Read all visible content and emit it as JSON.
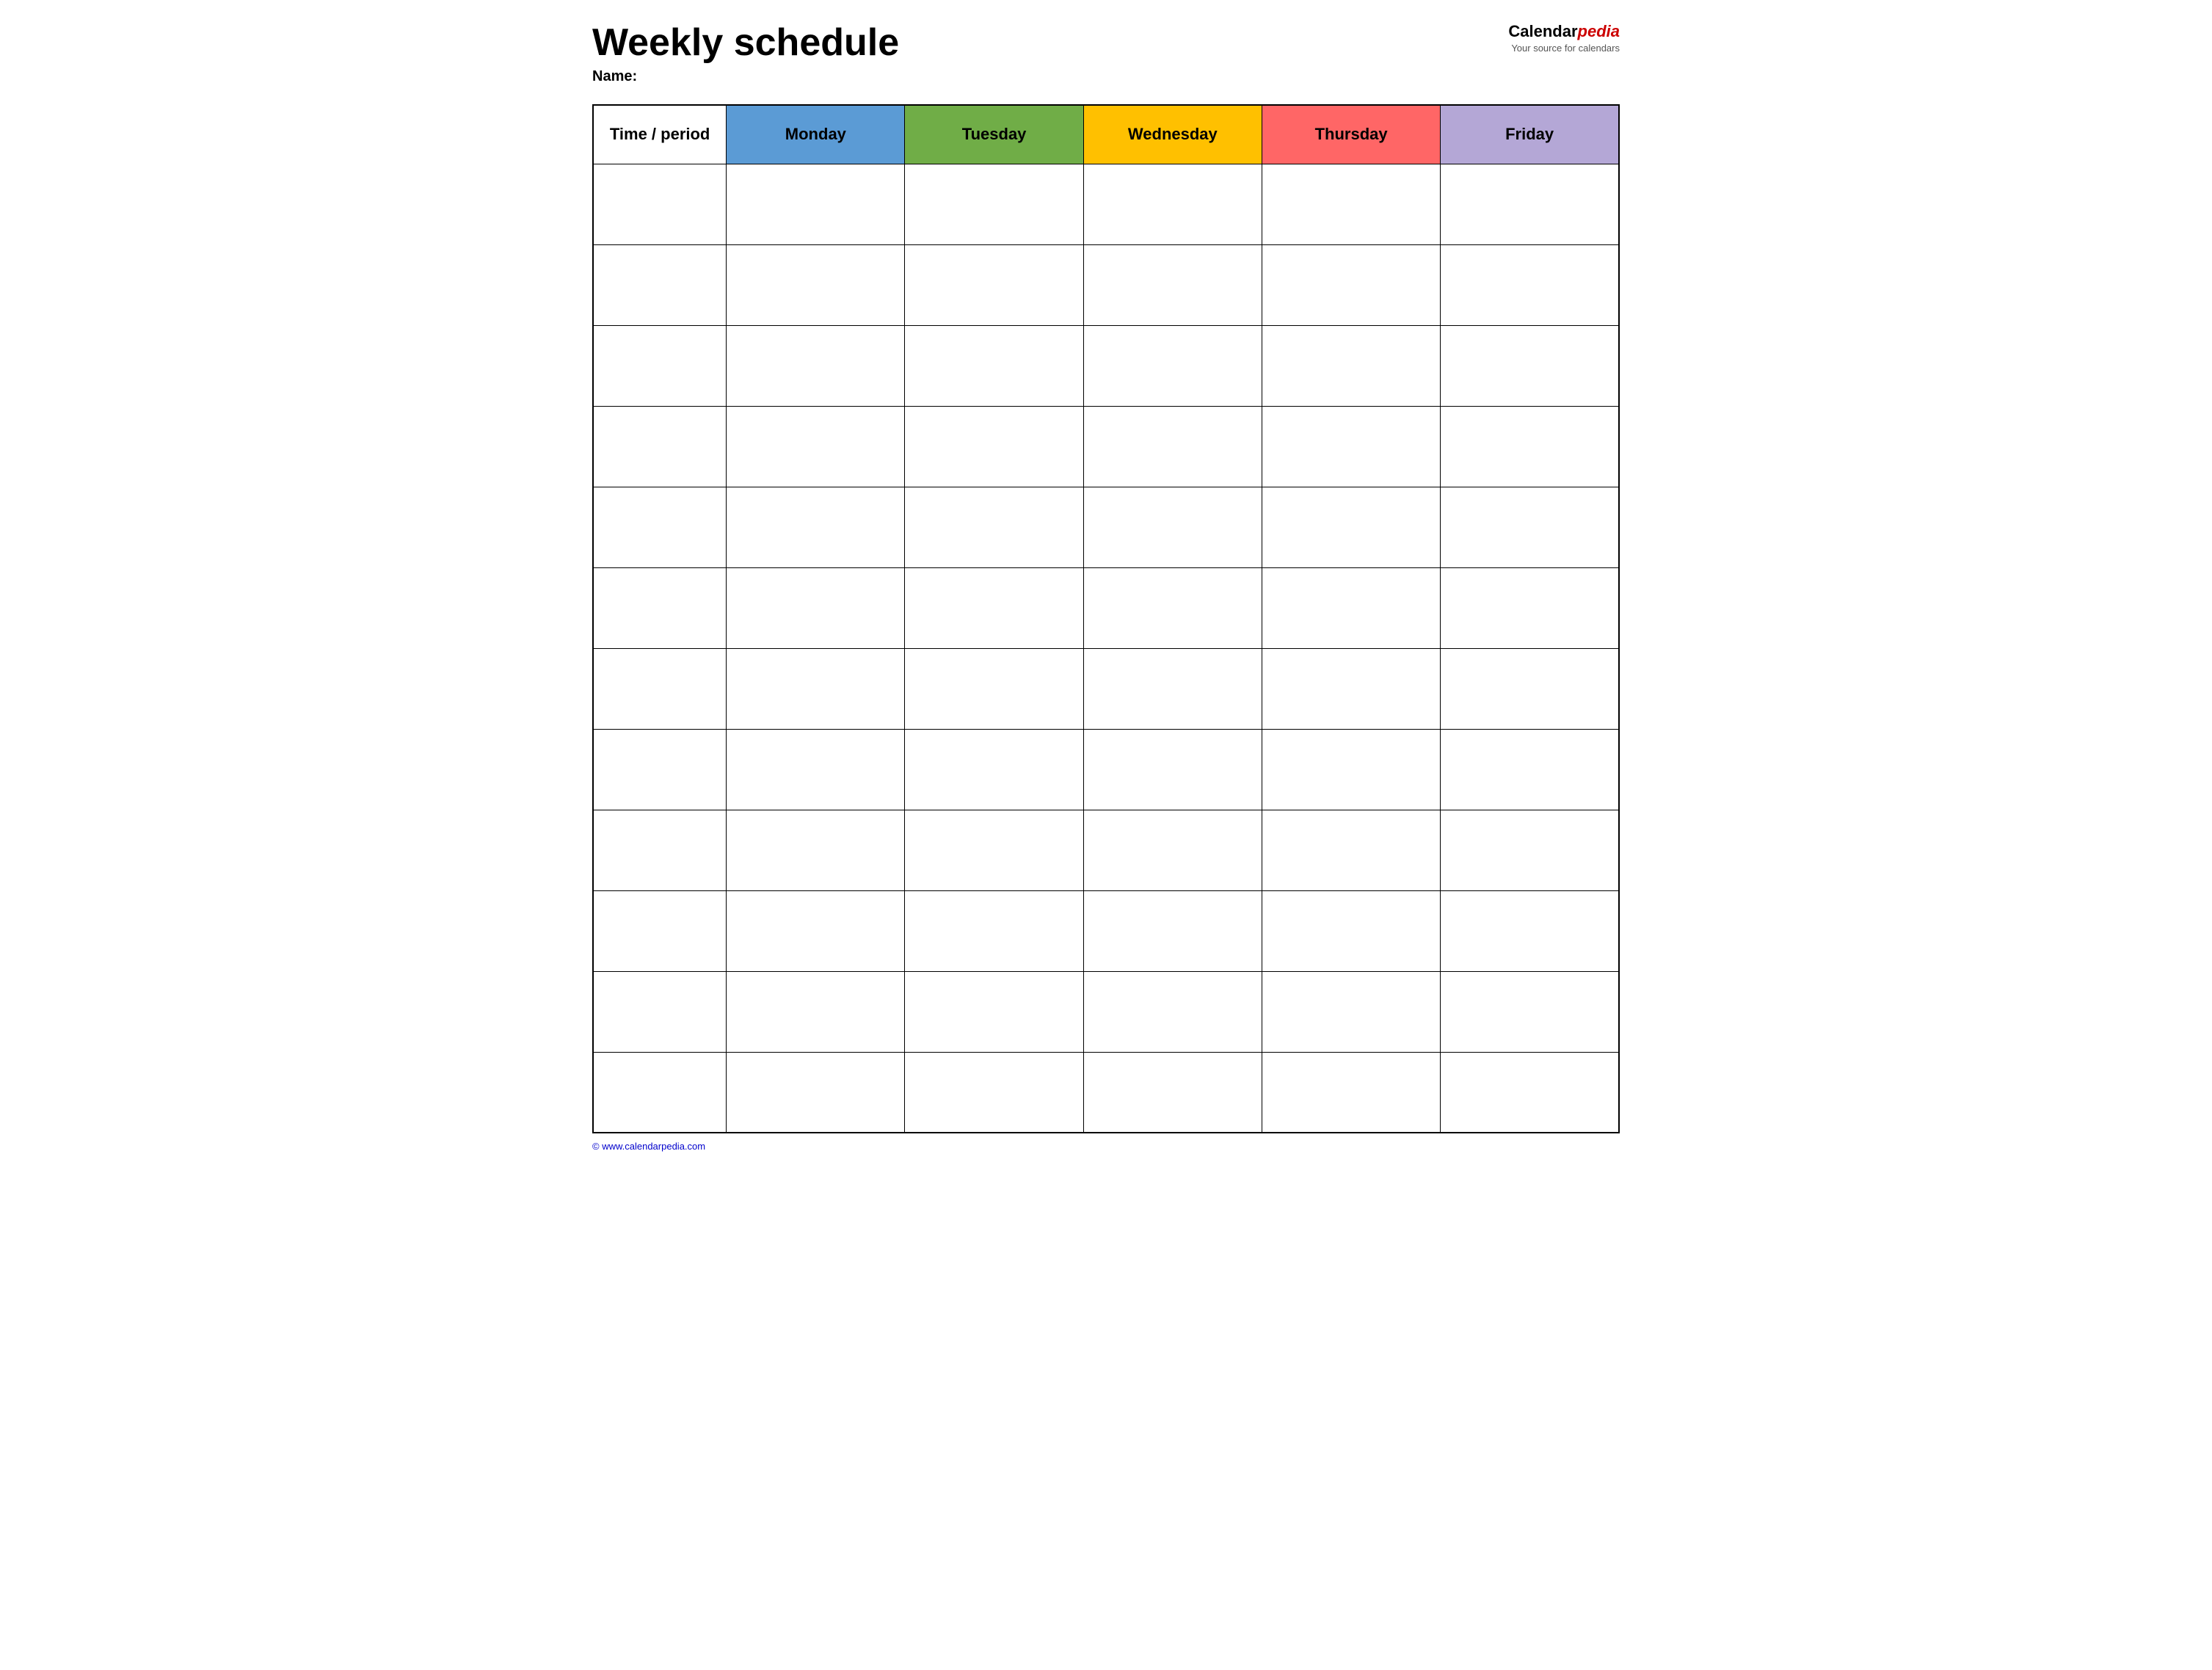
{
  "header": {
    "title": "Weekly schedule",
    "name_label": "Name:",
    "logo": {
      "calendar_text": "Calendar",
      "pedia_text": "pedia",
      "tagline": "Your source for calendars"
    }
  },
  "table": {
    "headers": [
      {
        "id": "time",
        "label": "Time / period",
        "color": "#ffffff"
      },
      {
        "id": "monday",
        "label": "Monday",
        "color": "#5b9bd5"
      },
      {
        "id": "tuesday",
        "label": "Tuesday",
        "color": "#70ad47"
      },
      {
        "id": "wednesday",
        "label": "Wednesday",
        "color": "#ffc000"
      },
      {
        "id": "thursday",
        "label": "Thursday",
        "color": "#ff6666"
      },
      {
        "id": "friday",
        "label": "Friday",
        "color": "#b4a7d6"
      }
    ],
    "row_count": 12
  },
  "footer": {
    "copyright": "© www.calendarpedia.com"
  }
}
